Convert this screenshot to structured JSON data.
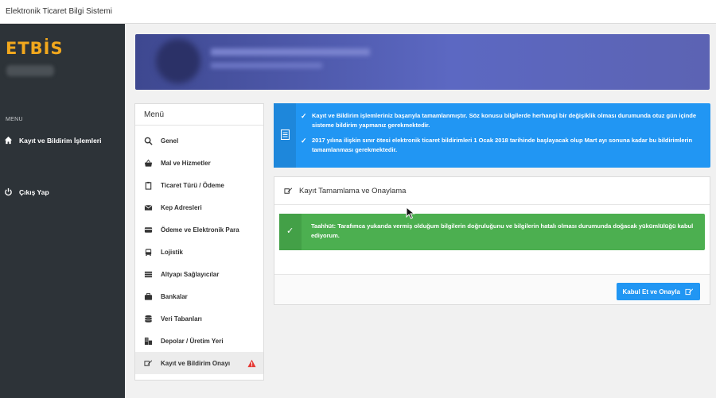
{
  "window": {
    "title": "Elektronik Ticaret Bilgi Sistemi"
  },
  "sidebar": {
    "logo": "ETBİS",
    "menu_heading": "MENU",
    "items": [
      {
        "label": "Kayıt ve Bildirim İşlemleri",
        "icon": "home-icon"
      },
      {
        "label": "Çıkış Yap",
        "icon": "power-icon"
      }
    ]
  },
  "menu_panel": {
    "title": "Menü",
    "items": [
      {
        "label": "Genel",
        "icon": "search-icon"
      },
      {
        "label": "Mal ve Hizmetler",
        "icon": "basket-icon"
      },
      {
        "label": "Ticaret Türü / Ödeme",
        "icon": "clipboard-icon"
      },
      {
        "label": "Kep Adresleri",
        "icon": "envelope-icon"
      },
      {
        "label": "Ödeme ve Elektronik Para",
        "icon": "credit-card-icon"
      },
      {
        "label": "Lojistik",
        "icon": "bus-icon"
      },
      {
        "label": "Altyapı Sağlayıcılar",
        "icon": "stack-icon"
      },
      {
        "label": "Bankalar",
        "icon": "briefcase-icon"
      },
      {
        "label": "Veri Tabanları",
        "icon": "database-icon"
      },
      {
        "label": "Depolar / Üretim Yeri",
        "icon": "building-icon"
      },
      {
        "label": "Kayıt ve Bildirim Onayı",
        "icon": "sign-icon",
        "active": true,
        "warning": true
      }
    ]
  },
  "info_alert": {
    "lines": [
      "Kayıt ve Bildirim işlemleriniz başarıyla tamamlanmıştır. Söz konusu bilgilerde herhangi bir değişiklik olması durumunda otuz gün içinde sisteme bildirim yapmanız gerekmektedir.",
      "2017 yılına ilişkin sınır ötesi elektronik ticaret bildirimleri 1 Ocak 2018 tarihinde başlayacak olup Mart ayı sonuna kadar bu bildirimlerin tamamlanması gerekmektedir."
    ]
  },
  "confirm_card": {
    "title": "Kayıt Tamamlama ve Onaylama",
    "commitment_text": "Taahhüt: Tarafımca yukarıda vermiş olduğum bilgilerin doğruluğunu ve bilgilerin hatalı olması durumunda doğacak yükümlülüğü kabul ediyorum.",
    "accept_button": "Kabul Et ve Onayla"
  },
  "colors": {
    "sidebar_bg": "#2d3338",
    "logo": "#f2a81d",
    "info": "#2196f3",
    "success": "#4caf50",
    "warning": "#e53935"
  }
}
